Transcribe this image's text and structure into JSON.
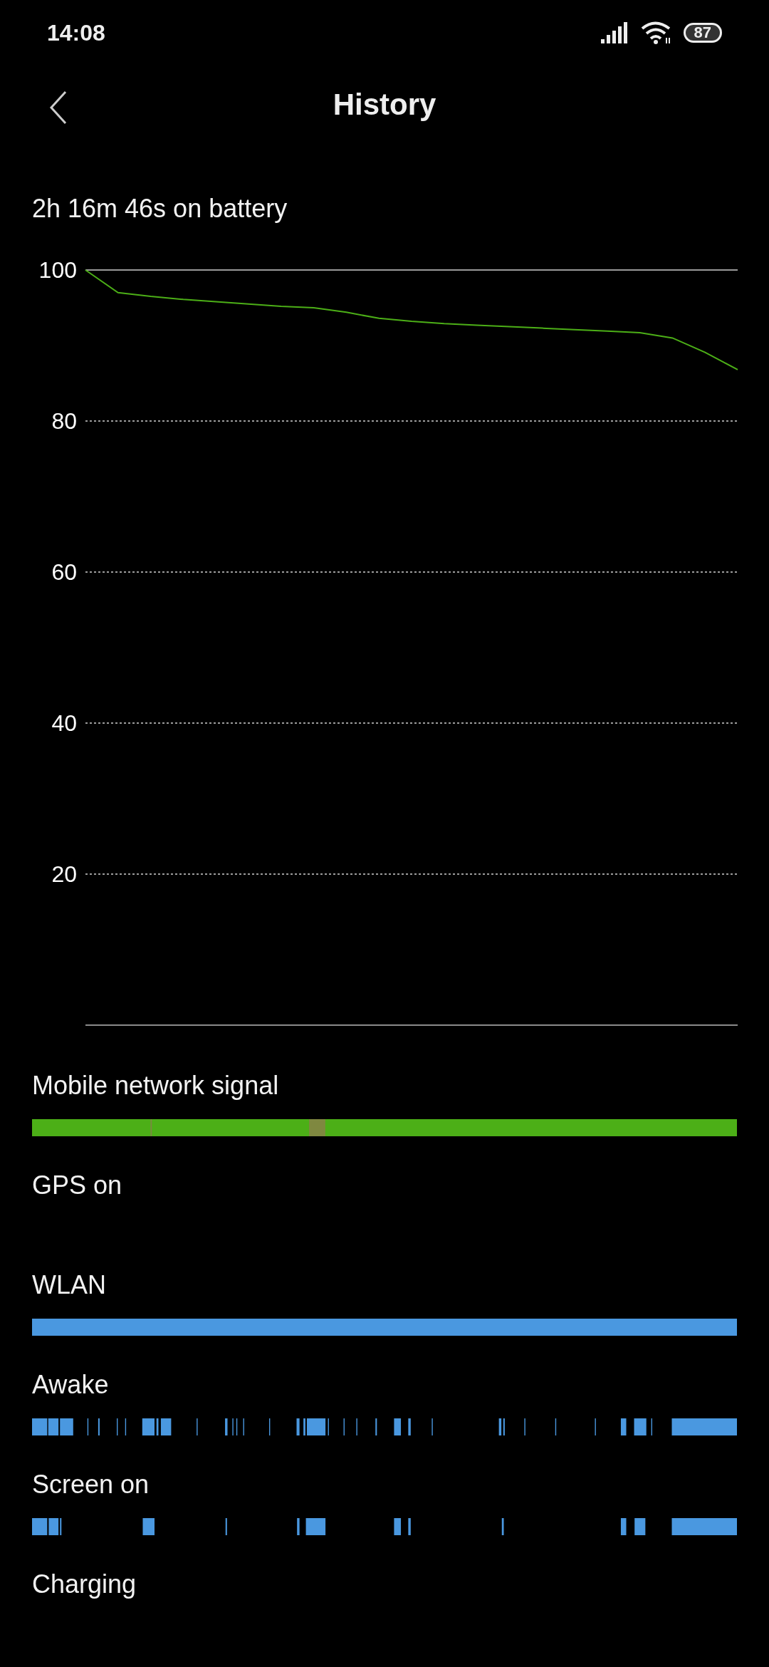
{
  "status_bar": {
    "time": "14:08",
    "battery": "87"
  },
  "header": {
    "title": "History"
  },
  "summary": "2h 16m 46s on battery",
  "battery_chart": {
    "chart_data": {
      "type": "line",
      "categories": [
        null,
        null,
        null,
        null,
        null,
        null,
        null,
        null,
        null,
        null,
        null,
        null,
        null,
        null,
        null,
        null,
        null,
        null,
        null,
        null,
        null
      ],
      "ylim": [
        0,
        100
      ],
      "grid": true,
      "yticks": [
        20,
        40,
        60,
        80,
        100
      ],
      "series": [
        {
          "color": "#4caf17",
          "values": [
            100,
            97.0,
            96.5,
            96.1,
            95.8,
            95.5,
            95.2,
            95.0,
            94.4,
            93.6,
            93.2,
            92.9,
            92.7,
            92.5,
            92.3,
            92.1,
            91.9,
            91.7,
            91.0,
            89.1,
            86.8
          ]
        }
      ]
    }
  },
  "timelines": [
    {
      "label": "Mobile network signal",
      "kind": "signal"
    },
    {
      "label": "GPS on",
      "kind": "empty"
    },
    {
      "label": "WLAN",
      "kind": "wifi"
    },
    {
      "label": "Awake",
      "kind": "awake"
    },
    {
      "label": "Screen on",
      "kind": "screen"
    },
    {
      "label": "Charging",
      "kind": "empty"
    }
  ]
}
